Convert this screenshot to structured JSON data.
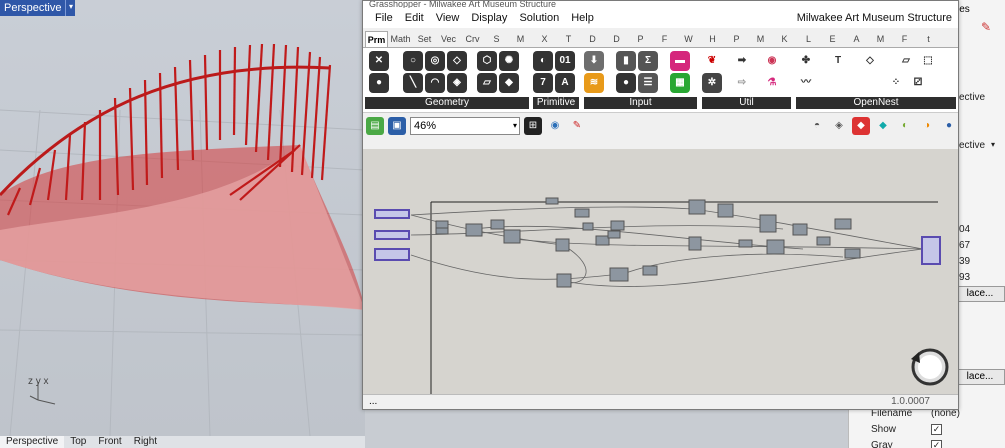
{
  "viewport": {
    "label": "Perspective",
    "dropdown_glyph": "▾",
    "axis_label": "z y x"
  },
  "view_tabs": [
    "Perspective",
    "Top",
    "Front",
    "Right"
  ],
  "props": {
    "title_frag": "ies",
    "rows": [
      {
        "val": "ective"
      },
      {
        "val": "ective"
      },
      {
        "val": "04"
      },
      {
        "val": "67"
      },
      {
        "val": "39"
      },
      {
        "val": "93"
      }
    ],
    "place_btn": "lace...",
    "place_btn2": "lace...",
    "filename_label": "Filename",
    "filename_val": "(none)",
    "show_label": "Show",
    "gray_label": "Gray"
  },
  "gh": {
    "title": "Grasshopper - Milwakee Art Museum Structure",
    "menus": [
      "File",
      "Edit",
      "View",
      "Display",
      "Solution",
      "Help"
    ],
    "doc_title": "Milwakee Art Museum Structure",
    "tabs": [
      "Prm",
      "Math",
      "Set",
      "Vec",
      "Crv",
      "S",
      "M",
      "X",
      "T",
      "D",
      "D",
      "P",
      "F",
      "W",
      "H",
      "P",
      "M",
      "K",
      "L",
      "E",
      "A",
      "M",
      "F",
      "t"
    ],
    "groups": [
      "Geometry",
      "Primitive",
      "Input",
      "Util",
      "OpenNest"
    ],
    "zoom": "46%",
    "status_left": "...",
    "version": "1.0.0007"
  },
  "colors": {
    "accent_blue": "#2f57a8",
    "render_red": "#cc1f1f"
  }
}
